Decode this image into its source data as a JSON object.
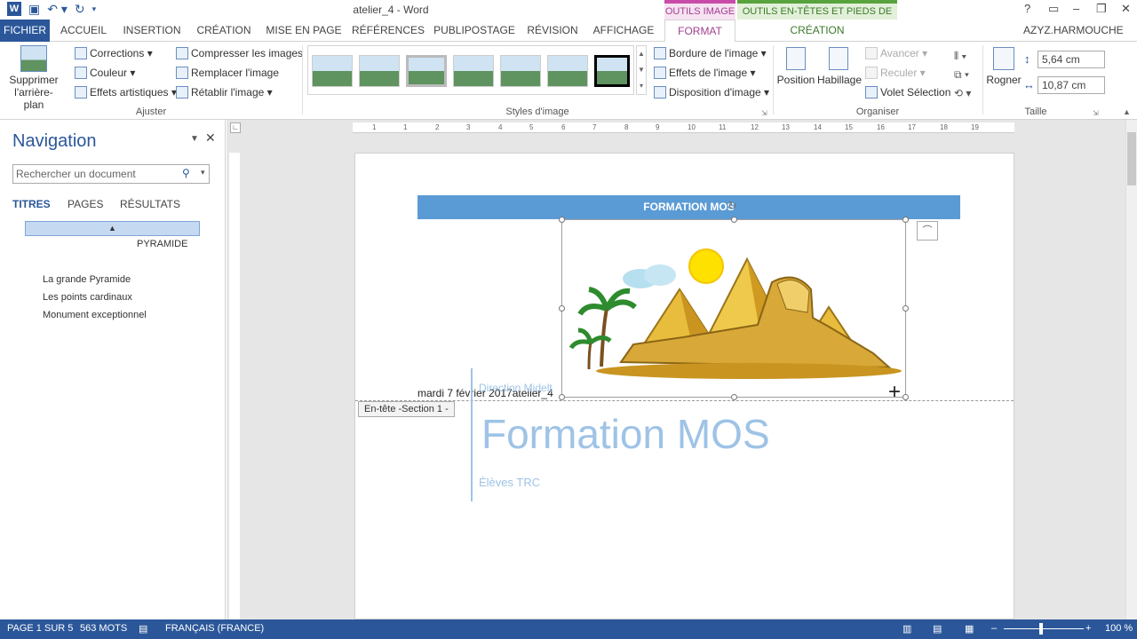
{
  "window": {
    "title": "atelier_4 - Word",
    "user": "AZYZ.HARMOUCHE",
    "help": "?",
    "minimize": "–",
    "restore": "❐",
    "close": "✕"
  },
  "context_headers": {
    "image_tools": "OUTILS IMAGE",
    "header_footer_tools": "OUTILS EN-TÊTES ET PIEDS DE PAGE"
  },
  "tabs": [
    "FICHIER",
    "ACCUEIL",
    "INSERTION",
    "CRÉATION",
    "MISE EN PAGE",
    "RÉFÉRENCES",
    "PUBLIPOSTAGE",
    "RÉVISION",
    "AFFICHAGE",
    "FORMAT",
    "CRÉATION"
  ],
  "ribbon": {
    "remove_bg": "Supprimer l'arrière-plan",
    "corrections": "Corrections ▾",
    "color": "Couleur ▾",
    "artistic": "Effets artistiques ▾",
    "compress": "Compresser les images",
    "replace": "Remplacer l'image",
    "reset": "Rétablir l'image ▾",
    "group_adjust": "Ajuster",
    "group_styles": "Styles d'image",
    "border": "Bordure de l'image ▾",
    "effects": "Effets de l'image ▾",
    "layout": "Disposition d'image ▾",
    "position": "Position",
    "wrap": "Habillage",
    "forward": "Avancer ▾",
    "backward": "Reculer ▾",
    "selection_pane": "Volet Sélection",
    "group_arrange": "Organiser",
    "crop": "Rogner",
    "height": "5,64 cm",
    "width": "10,87 cm",
    "group_size": "Taille"
  },
  "nav": {
    "title": "Navigation",
    "search_placeholder": "Rechercher un document",
    "tabs": [
      "TITRES",
      "PAGES",
      "RÉSULTATS"
    ],
    "heading": "PYRAMIDE",
    "items": [
      "La grande Pyramide",
      "Les points cardinaux",
      "Monument exceptionnel"
    ]
  },
  "ruler_numbers": [
    "1",
    "1",
    "2",
    "3",
    "4",
    "5",
    "6",
    "7",
    "8",
    "9",
    "10",
    "11",
    "12",
    "13",
    "14",
    "15",
    "16",
    "17",
    "18",
    "19"
  ],
  "document": {
    "header_banner": "FORMATION MOS",
    "header_date": "mardi 7 février 2017atelier_4",
    "section_label": "En-tête -Section 1 -",
    "direction": "Direction Midelt",
    "cover_title": "Formation MOS",
    "cover_subtitle": "Élèves TRC"
  },
  "status": {
    "page": "PAGE 1 SUR 5",
    "words": "563 MOTS",
    "language": "FRANÇAIS (FRANCE)",
    "zoom": "100 %"
  },
  "colors": {
    "word_blue": "#2b579a",
    "banner_blue": "#5b9bd5",
    "image_tools": "#a23f8f",
    "hf_tools": "#3c7a29"
  }
}
